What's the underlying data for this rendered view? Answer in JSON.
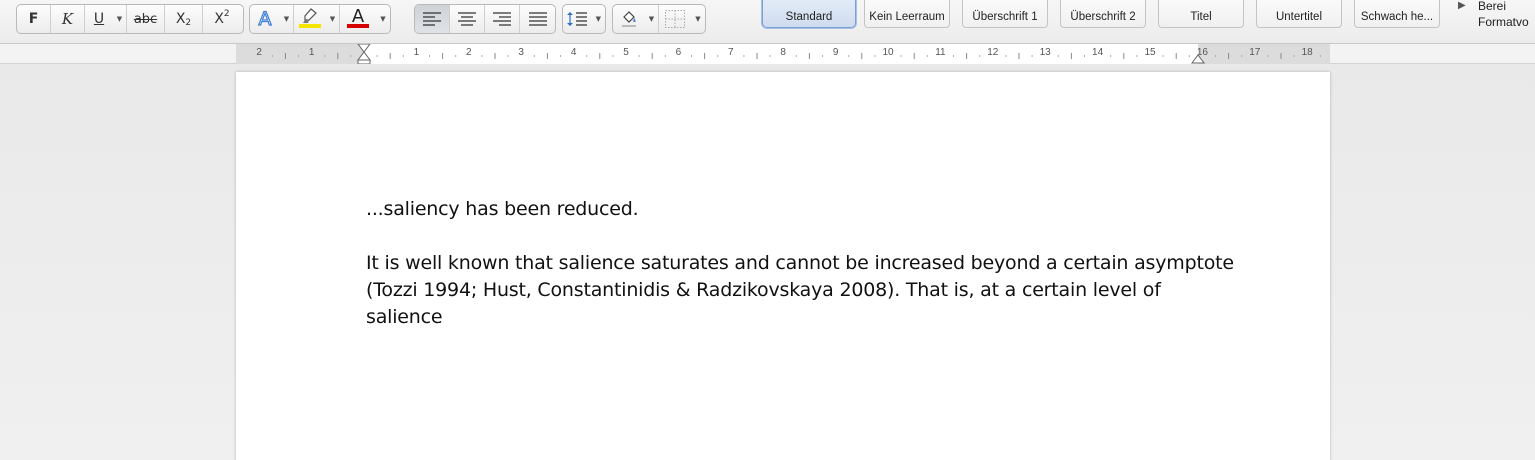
{
  "toolbar": {
    "font_buttons": {
      "bold": "F",
      "italic": "K",
      "underline": "U",
      "strike": "abc",
      "subscript": "X",
      "subscript_small": "2",
      "superscript": "X",
      "superscript_small": "2"
    },
    "text_effects_glyph": "A",
    "font_color_glyph": "A",
    "highlight_color": "#f5e400",
    "font_color": "#d40000",
    "styles": [
      {
        "label": "Standard",
        "selected": true
      },
      {
        "label": "Kein Leerraum"
      },
      {
        "label": "Überschrift 1"
      },
      {
        "label": "Überschrift 2"
      },
      {
        "label": "Titel"
      },
      {
        "label": "Untertitel"
      },
      {
        "label": "Schwach he..."
      }
    ],
    "format_pane_line1": "Berei",
    "format_pane_line2": "Formatvo"
  },
  "ruler": {
    "labels_left": [
      "2",
      "1"
    ],
    "labels_right": [
      "1",
      "2",
      "3",
      "4",
      "5",
      "6",
      "7",
      "8",
      "9",
      "10",
      "11",
      "12",
      "13",
      "14",
      "15",
      "16",
      "17",
      "18"
    ]
  },
  "document": {
    "paragraph1": "...saliency has been reduced.",
    "paragraph2_lines": [
      "It is well known that salience saturates and cannot be increased beyond a certain asymptote",
      "(Tozzi 1994; Hust, Constantinidis & Radzikovskaya 2008). That is, at a certain level of",
      "salience"
    ]
  }
}
